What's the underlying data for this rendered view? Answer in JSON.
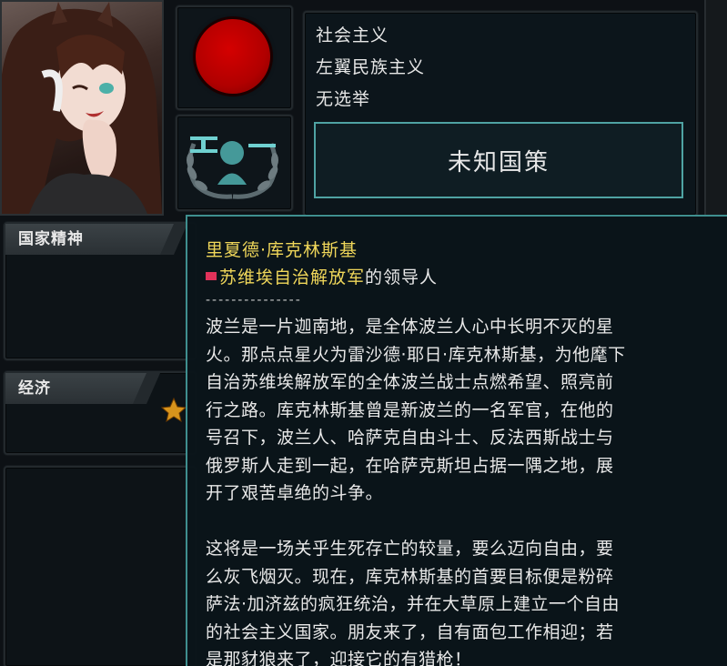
{
  "leader": {
    "portrait_label": "leader-portrait",
    "ideology_color": "#c00000"
  },
  "info": {
    "lines": [
      "社会主义",
      "左翼民族主义",
      "无选举"
    ],
    "national_focus": "未知国策"
  },
  "sections": {
    "national_spirit": "国家精神",
    "economy": "经济"
  },
  "tooltip": {
    "title": "里夏德·库克林斯基",
    "faction": "苏维埃自治解放军",
    "role_suffix": "的领导人",
    "divider": "---------------",
    "body": "波兰是一片迦南地，是全体波兰人心中长明不灭的星\n火。那点点星火为雷沙德·耶日·库克林斯基，为他麾下\n自治苏维埃解放军的全体波兰战士点燃希望、照亮前\n行之路。库克林斯基曾是新波兰的一名军官，在他的\n号召下，波兰人、哈萨克自由斗士、反法西斯战士与\n俄罗斯人走到一起，在哈萨克斯坦占据一隅之地，展\n开了艰苦卓绝的斗争。\n\n这将是一场关乎生死存亡的较量，要么迈向自由，要\n么灰飞烟灭。现在，库克林斯基的首要目标便是粉碎\n萨法·加济兹的疯狂统治，并在大草原上建立一个自由\n的社会主义国家。朋友来了，自有面包工作相迎；若\n是那豺狼来了，迎接它的有猎枪！"
  },
  "colors": {
    "accent_teal": "#4fa3a3",
    "title_yellow": "#f0d75a",
    "bullet_red": "#e0325a"
  }
}
